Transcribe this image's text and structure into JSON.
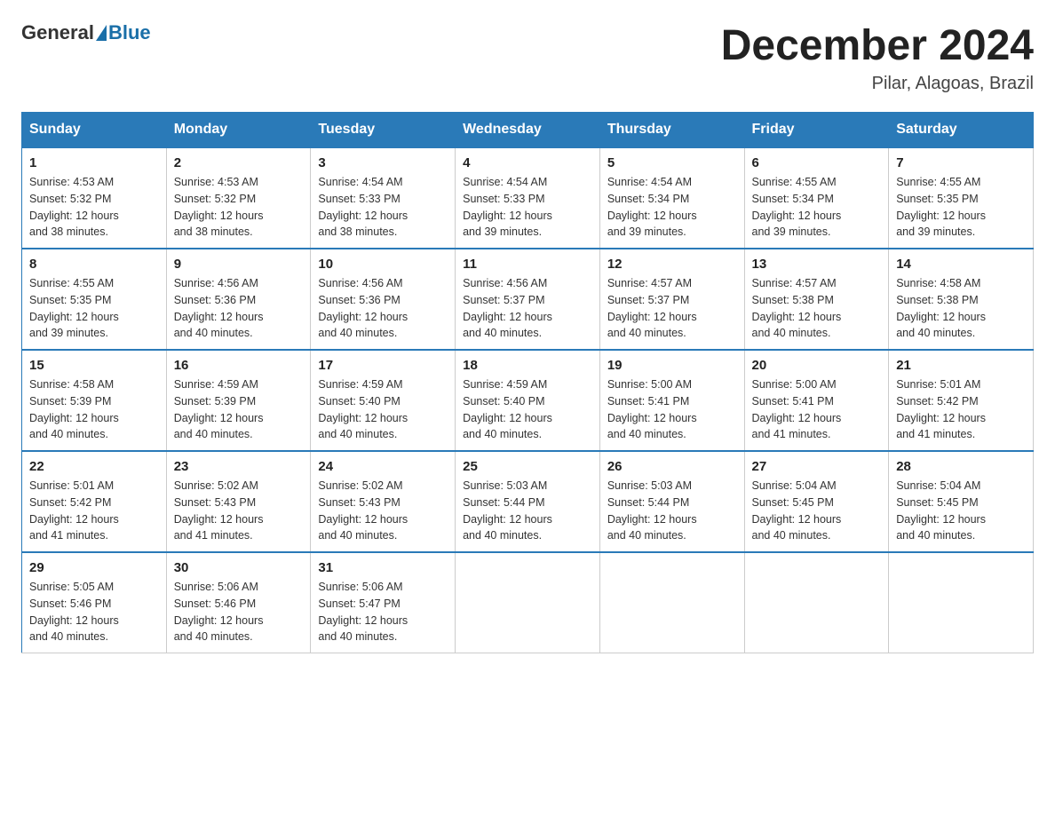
{
  "header": {
    "logo_general": "General",
    "logo_blue": "Blue",
    "month_title": "December 2024",
    "location": "Pilar, Alagoas, Brazil"
  },
  "days_of_week": [
    "Sunday",
    "Monday",
    "Tuesday",
    "Wednesday",
    "Thursday",
    "Friday",
    "Saturday"
  ],
  "weeks": [
    [
      {
        "day": "1",
        "sunrise": "4:53 AM",
        "sunset": "5:32 PM",
        "daylight": "12 hours and 38 minutes."
      },
      {
        "day": "2",
        "sunrise": "4:53 AM",
        "sunset": "5:32 PM",
        "daylight": "12 hours and 38 minutes."
      },
      {
        "day": "3",
        "sunrise": "4:54 AM",
        "sunset": "5:33 PM",
        "daylight": "12 hours and 38 minutes."
      },
      {
        "day": "4",
        "sunrise": "4:54 AM",
        "sunset": "5:33 PM",
        "daylight": "12 hours and 39 minutes."
      },
      {
        "day": "5",
        "sunrise": "4:54 AM",
        "sunset": "5:34 PM",
        "daylight": "12 hours and 39 minutes."
      },
      {
        "day": "6",
        "sunrise": "4:55 AM",
        "sunset": "5:34 PM",
        "daylight": "12 hours and 39 minutes."
      },
      {
        "day": "7",
        "sunrise": "4:55 AM",
        "sunset": "5:35 PM",
        "daylight": "12 hours and 39 minutes."
      }
    ],
    [
      {
        "day": "8",
        "sunrise": "4:55 AM",
        "sunset": "5:35 PM",
        "daylight": "12 hours and 39 minutes."
      },
      {
        "day": "9",
        "sunrise": "4:56 AM",
        "sunset": "5:36 PM",
        "daylight": "12 hours and 40 minutes."
      },
      {
        "day": "10",
        "sunrise": "4:56 AM",
        "sunset": "5:36 PM",
        "daylight": "12 hours and 40 minutes."
      },
      {
        "day": "11",
        "sunrise": "4:56 AM",
        "sunset": "5:37 PM",
        "daylight": "12 hours and 40 minutes."
      },
      {
        "day": "12",
        "sunrise": "4:57 AM",
        "sunset": "5:37 PM",
        "daylight": "12 hours and 40 minutes."
      },
      {
        "day": "13",
        "sunrise": "4:57 AM",
        "sunset": "5:38 PM",
        "daylight": "12 hours and 40 minutes."
      },
      {
        "day": "14",
        "sunrise": "4:58 AM",
        "sunset": "5:38 PM",
        "daylight": "12 hours and 40 minutes."
      }
    ],
    [
      {
        "day": "15",
        "sunrise": "4:58 AM",
        "sunset": "5:39 PM",
        "daylight": "12 hours and 40 minutes."
      },
      {
        "day": "16",
        "sunrise": "4:59 AM",
        "sunset": "5:39 PM",
        "daylight": "12 hours and 40 minutes."
      },
      {
        "day": "17",
        "sunrise": "4:59 AM",
        "sunset": "5:40 PM",
        "daylight": "12 hours and 40 minutes."
      },
      {
        "day": "18",
        "sunrise": "4:59 AM",
        "sunset": "5:40 PM",
        "daylight": "12 hours and 40 minutes."
      },
      {
        "day": "19",
        "sunrise": "5:00 AM",
        "sunset": "5:41 PM",
        "daylight": "12 hours and 40 minutes."
      },
      {
        "day": "20",
        "sunrise": "5:00 AM",
        "sunset": "5:41 PM",
        "daylight": "12 hours and 41 minutes."
      },
      {
        "day": "21",
        "sunrise": "5:01 AM",
        "sunset": "5:42 PM",
        "daylight": "12 hours and 41 minutes."
      }
    ],
    [
      {
        "day": "22",
        "sunrise": "5:01 AM",
        "sunset": "5:42 PM",
        "daylight": "12 hours and 41 minutes."
      },
      {
        "day": "23",
        "sunrise": "5:02 AM",
        "sunset": "5:43 PM",
        "daylight": "12 hours and 41 minutes."
      },
      {
        "day": "24",
        "sunrise": "5:02 AM",
        "sunset": "5:43 PM",
        "daylight": "12 hours and 40 minutes."
      },
      {
        "day": "25",
        "sunrise": "5:03 AM",
        "sunset": "5:44 PM",
        "daylight": "12 hours and 40 minutes."
      },
      {
        "day": "26",
        "sunrise": "5:03 AM",
        "sunset": "5:44 PM",
        "daylight": "12 hours and 40 minutes."
      },
      {
        "day": "27",
        "sunrise": "5:04 AM",
        "sunset": "5:45 PM",
        "daylight": "12 hours and 40 minutes."
      },
      {
        "day": "28",
        "sunrise": "5:04 AM",
        "sunset": "5:45 PM",
        "daylight": "12 hours and 40 minutes."
      }
    ],
    [
      {
        "day": "29",
        "sunrise": "5:05 AM",
        "sunset": "5:46 PM",
        "daylight": "12 hours and 40 minutes."
      },
      {
        "day": "30",
        "sunrise": "5:06 AM",
        "sunset": "5:46 PM",
        "daylight": "12 hours and 40 minutes."
      },
      {
        "day": "31",
        "sunrise": "5:06 AM",
        "sunset": "5:47 PM",
        "daylight": "12 hours and 40 minutes."
      },
      null,
      null,
      null,
      null
    ]
  ],
  "labels": {
    "sunrise": "Sunrise:",
    "sunset": "Sunset:",
    "daylight": "Daylight:"
  }
}
